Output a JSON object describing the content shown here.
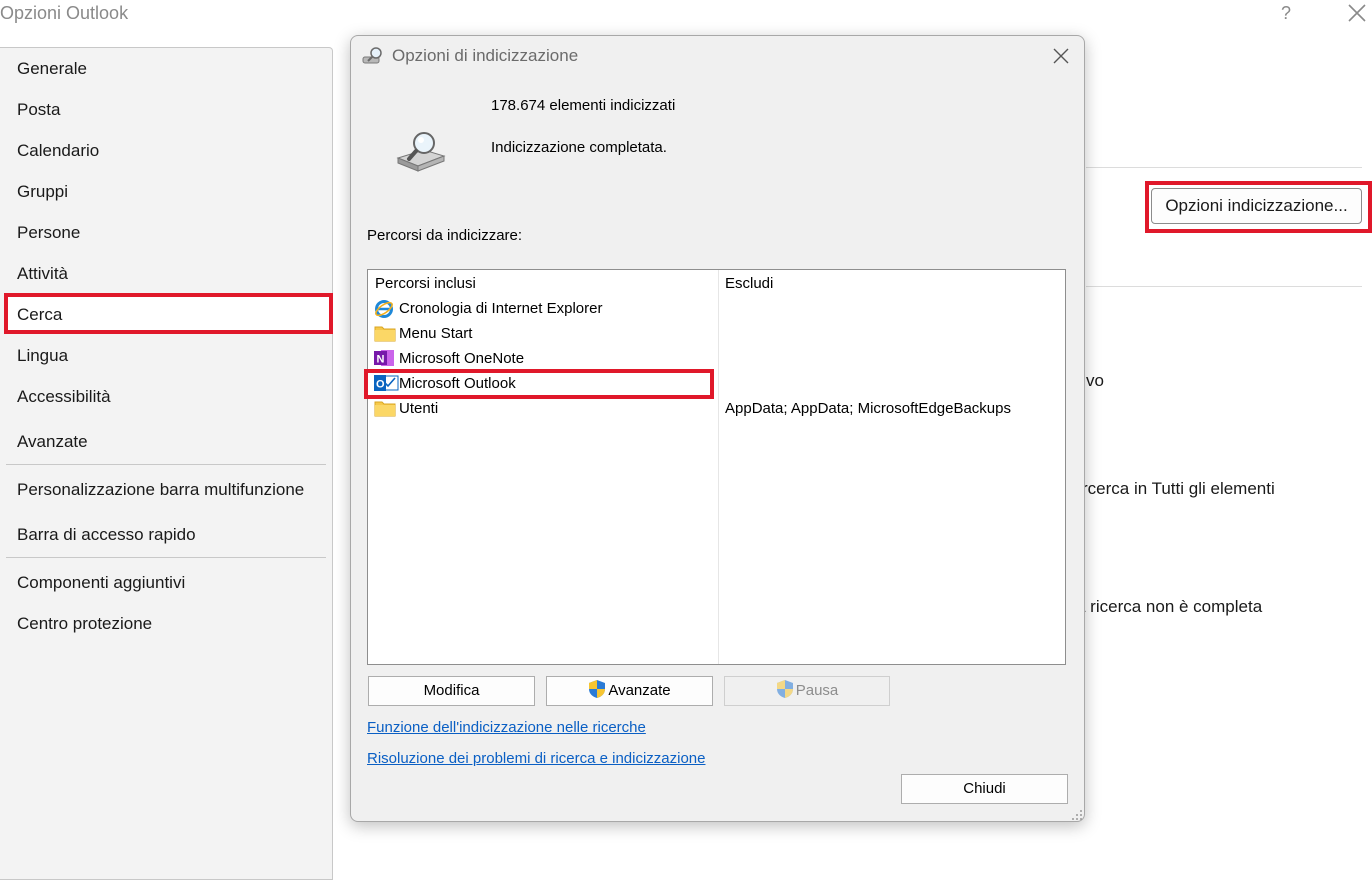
{
  "window": {
    "title": "Opzioni Outlook",
    "help": "?"
  },
  "sidebar": {
    "items": [
      {
        "label": "Generale"
      },
      {
        "label": "Posta"
      },
      {
        "label": "Calendario"
      },
      {
        "label": "Gruppi"
      },
      {
        "label": "Persone"
      },
      {
        "label": "Attività"
      },
      {
        "label": "Cerca"
      },
      {
        "label": "Lingua"
      },
      {
        "label": "Accessibilità"
      },
      {
        "label": "Avanzate"
      },
      {
        "label": "Personalizzazione barra multifunzione"
      },
      {
        "label": "Barra di accesso rapido"
      },
      {
        "label": "Componenti aggiuntivi"
      },
      {
        "label": "Centro protezione"
      }
    ],
    "selected": "Cerca"
  },
  "background": {
    "indexing_button": "Opzioni indicizzazione...",
    "partial_text_1": "vo",
    "partial_text_2": "rcerca in Tutti gli elementi",
    "partial_text_3": "a ricerca non è completa"
  },
  "dialog": {
    "title": "Opzioni di indicizzazione",
    "items_count": "178.674 elementi indicizzati",
    "status": "Indicizzazione completata.",
    "locations_label": "Percorsi da indicizzare:",
    "columns": [
      "Percorsi inclusi",
      "Escludi"
    ],
    "rows": [
      {
        "name": "Cronologia di Internet Explorer",
        "exclude": "",
        "icon": "internet-explorer-icon"
      },
      {
        "name": "Menu Start",
        "exclude": "",
        "icon": "folder-icon"
      },
      {
        "name": "Microsoft OneNote",
        "exclude": "",
        "icon": "onenote-icon"
      },
      {
        "name": "Microsoft Outlook",
        "exclude": "",
        "icon": "outlook-icon"
      },
      {
        "name": "Utenti",
        "exclude": "AppData; AppData; MicrosoftEdgeBackups",
        "icon": "folder-icon"
      }
    ],
    "buttons": {
      "modify": "Modifica",
      "advanced": "Avanzate",
      "pause": "Pausa",
      "close": "Chiudi"
    },
    "links": {
      "how_indexing": "Funzione dell'indicizzazione nelle ricerche",
      "troubleshoot": "Risoluzione dei problemi di ricerca e indicizzazione"
    }
  },
  "colors": {
    "highlight": "#e0182a",
    "link": "#0a5fc4",
    "sidebar_bg": "#f3f3f3",
    "dialog_bg": "#f0f0f0"
  }
}
